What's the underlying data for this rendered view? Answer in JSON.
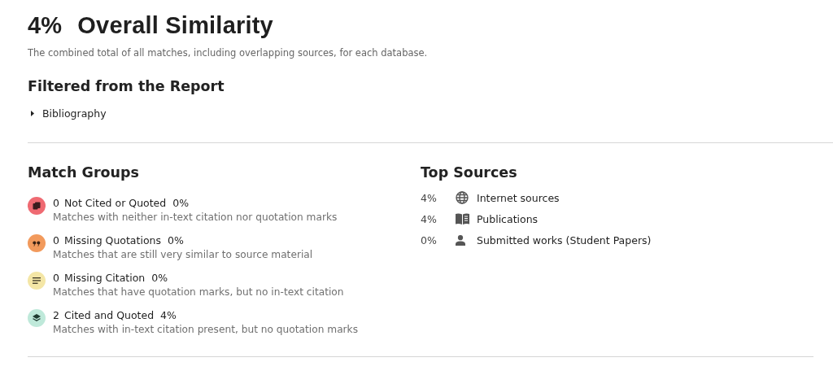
{
  "header": {
    "percent": "4%",
    "title": "Overall Similarity",
    "description": "The combined total of all matches, including overlapping sources, for each database."
  },
  "filtered": {
    "heading": "Filtered from the Report",
    "items": [
      {
        "label": "Bibliography",
        "expanded": false
      }
    ]
  },
  "match_groups": {
    "heading": "Match Groups",
    "items": [
      {
        "kind": "not-cited",
        "color": "#ef6a72",
        "count": "0",
        "label": "Not Cited or Quoted",
        "percent": "0%",
        "description": "Matches with neither in-text citation nor quotation marks"
      },
      {
        "kind": "missing-quotations",
        "color": "#f29a5c",
        "count": "0",
        "label": "Missing Quotations",
        "percent": "0%",
        "description": "Matches that are still very similar to source material"
      },
      {
        "kind": "missing-citation",
        "color": "#f4e6a6",
        "count": "0",
        "label": "Missing Citation",
        "percent": "0%",
        "description": "Matches that have quotation marks, but no in-text citation"
      },
      {
        "kind": "cited-quoted",
        "color": "#bfe9da",
        "count": "2",
        "label": "Cited and Quoted",
        "percent": "4%",
        "description": "Matches with in-text citation present, but no quotation marks"
      }
    ]
  },
  "top_sources": {
    "heading": "Top Sources",
    "items": [
      {
        "kind": "internet",
        "percent": "4%",
        "label": "Internet sources"
      },
      {
        "kind": "publications",
        "percent": "4%",
        "label": "Publications"
      },
      {
        "kind": "submitted",
        "percent": "0%",
        "label": "Submitted works (Student Papers)"
      }
    ]
  }
}
